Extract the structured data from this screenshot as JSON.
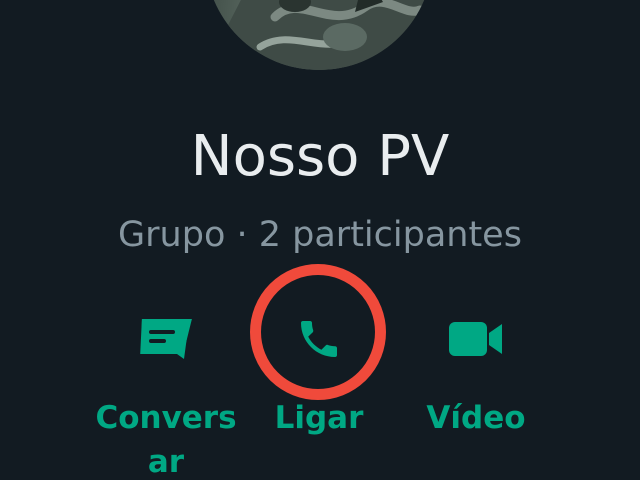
{
  "group": {
    "name": "Nosso PV",
    "meta": "Grupo · 2 participantes"
  },
  "actions": [
    {
      "label": "Conversar",
      "icon": "message-icon"
    },
    {
      "label": "Ligar",
      "icon": "phone-icon"
    },
    {
      "label": "Vídeo",
      "icon": "video-camera-icon"
    }
  ],
  "colors": {
    "background": "#121b22",
    "title": "#e9edef",
    "subtitle": "#8696a0",
    "accent": "#00a884",
    "highlight": "#f04a3b"
  }
}
